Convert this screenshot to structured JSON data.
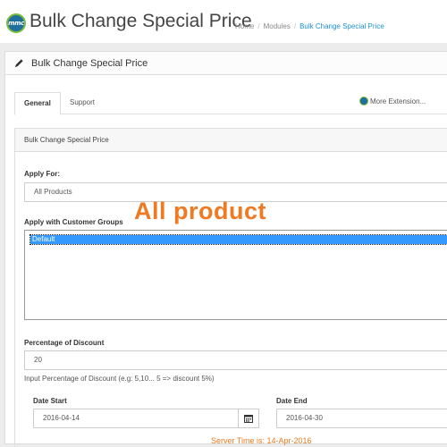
{
  "header": {
    "logo_text": "mmc",
    "title": "Bulk Change Special Price",
    "breadcrumb": [
      "Home",
      "Modules",
      "Bulk Change Special Price"
    ]
  },
  "panel": {
    "heading": "Bulk Change Special Price",
    "tabs": [
      {
        "label": "General",
        "active": true
      },
      {
        "label": "Support",
        "active": false
      }
    ],
    "more_extensions": "More Extension..."
  },
  "form": {
    "section_title": "Bulk Change Special Price",
    "apply_for_label": "Apply For:",
    "apply_for_value": "All Products",
    "customer_groups_label": "Apply with Customer Groups",
    "customer_groups_selected": "Default",
    "discount_label": "Percentage of Discount",
    "discount_value": "20",
    "discount_help": "Input Percentage of Discount (e.g: 5,10... 5 => discount 5%)",
    "date_start_label": "Date Start",
    "date_start_value": "2016-04-14",
    "date_end_label": "Date End",
    "date_end_value": "2016-04-30",
    "server_time": "Server Time is: 14-Apr-2016"
  },
  "annotation": "All product",
  "colors": {
    "accent": "#ef7a21",
    "link": "#1e91cf",
    "selection": "#3399ff"
  }
}
